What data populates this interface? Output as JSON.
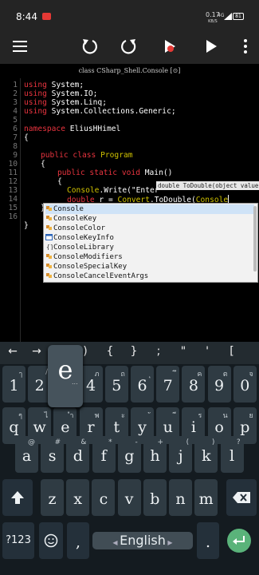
{
  "status_bar": {
    "time": "8:44",
    "speed_value": "0.17",
    "speed_unit": "KB/S",
    "network": "4G",
    "battery": "81"
  },
  "toolbar": {
    "menu_icon": "hamburger-menu-icon",
    "undo_icon": "undo-icon",
    "redo_icon": "redo-icon",
    "compile_icon": "build-icon",
    "run_icon": "play-icon",
    "more_icon": "more-vert-icon"
  },
  "editor": {
    "header": "class CSharp_Shell.Console [⊙]",
    "line_numbers": [
      "1",
      "2",
      "3",
      "4",
      "5",
      "6",
      "7",
      "8",
      "9",
      "10",
      "11",
      "12",
      "13",
      "14",
      "15",
      "16"
    ],
    "lines": {
      "l1_kw": "using",
      "l1_rest": " System;",
      "l2_kw": "using",
      "l2_rest": " System.IO;",
      "l3_kw": "using",
      "l3_rest": " System.Linq;",
      "l4_kw": "using",
      "l4_rest": " System.Collections.Generic;",
      "l6_kw": "namespace",
      "l6_rest": " EliusHHimel",
      "l7": "{",
      "l9_kw": "public class",
      "l9_ty": " Program",
      "l10": "{",
      "l11_kw": "public static void",
      "l11_rest": " Main()",
      "l12": "{",
      "l13_ty": "Console",
      "l13_rest": ".Write(\"Enter",
      "l14_kw": "double",
      "l14_rest": " r = ",
      "l14_ty1": "Convert",
      "l14_mid": ".ToDouble(",
      "l14_ty2": "Console",
      "l15": "}",
      "l16": "}"
    },
    "hint": "double ToDouble(object value)",
    "suggestions": [
      {
        "label": "Console",
        "kind": "class"
      },
      {
        "label": "ConsoleKey",
        "kind": "class"
      },
      {
        "label": "ConsoleColor",
        "kind": "class"
      },
      {
        "label": "ConsoleKeyInfo",
        "kind": "struct"
      },
      {
        "label": "ConsoleLibrary",
        "kind": "namespace"
      },
      {
        "label": "ConsoleModifiers",
        "kind": "class"
      },
      {
        "label": "ConsoleSpecialKey",
        "kind": "class"
      },
      {
        "label": "ConsoleCancelEventArgs",
        "kind": "class"
      }
    ]
  },
  "keyboard": {
    "symbols": [
      "←",
      "→",
      "(",
      ")",
      "{",
      "}",
      ";",
      "\"",
      "'",
      "["
    ],
    "row1": [
      {
        "k": "1",
        "a": "ๅ"
      },
      {
        "k": "2",
        "a": "/"
      },
      {
        "k": "3",
        "a": "-"
      },
      {
        "k": "4",
        "a": "ภ"
      },
      {
        "k": "5",
        "a": "ถ"
      },
      {
        "k": "6",
        "a": "ุ"
      },
      {
        "k": "7",
        "a": "ึ"
      },
      {
        "k": "8",
        "a": "ค"
      },
      {
        "k": "9",
        "a": "ต"
      },
      {
        "k": "0",
        "a": "จ"
      }
    ],
    "row2": [
      {
        "k": "q",
        "a": "ๆ"
      },
      {
        "k": "w",
        "a": "ไ"
      },
      {
        "k": "e",
        "a": "ำ"
      },
      {
        "k": "r",
        "a": "พ"
      },
      {
        "k": "t",
        "a": "ะ"
      },
      {
        "k": "y",
        "a": "ั"
      },
      {
        "k": "u",
        "a": "ี"
      },
      {
        "k": "i",
        "a": "ร"
      },
      {
        "k": "o",
        "a": "น"
      },
      {
        "k": "p",
        "a": "ย"
      }
    ],
    "row3": [
      {
        "k": "a",
        "a": "@"
      },
      {
        "k": "s",
        "a": "#"
      },
      {
        "k": "d",
        "a": "&"
      },
      {
        "k": "f",
        "a": "*"
      },
      {
        "k": "g",
        "a": "-"
      },
      {
        "k": "h",
        "a": "+"
      },
      {
        "k": "j",
        "a": "("
      },
      {
        "k": "k",
        "a": ")"
      },
      {
        "k": "l",
        "a": "?"
      }
    ],
    "row4": [
      {
        "k": "z",
        "a": ""
      },
      {
        "k": "x",
        "a": ""
      },
      {
        "k": "c",
        "a": ""
      },
      {
        "k": "v",
        "a": ""
      },
      {
        "k": "b",
        "a": ""
      },
      {
        "k": "n",
        "a": ""
      },
      {
        "k": "m",
        "a": ""
      }
    ],
    "popup_key": "e",
    "sym_key": "?123",
    "comma": ",",
    "period": ".",
    "space_label": "English",
    "shift_icon": "shift-icon",
    "backspace_icon": "backspace-icon",
    "emoji_icon": "emoji-icon",
    "enter_icon": "enter-icon"
  }
}
